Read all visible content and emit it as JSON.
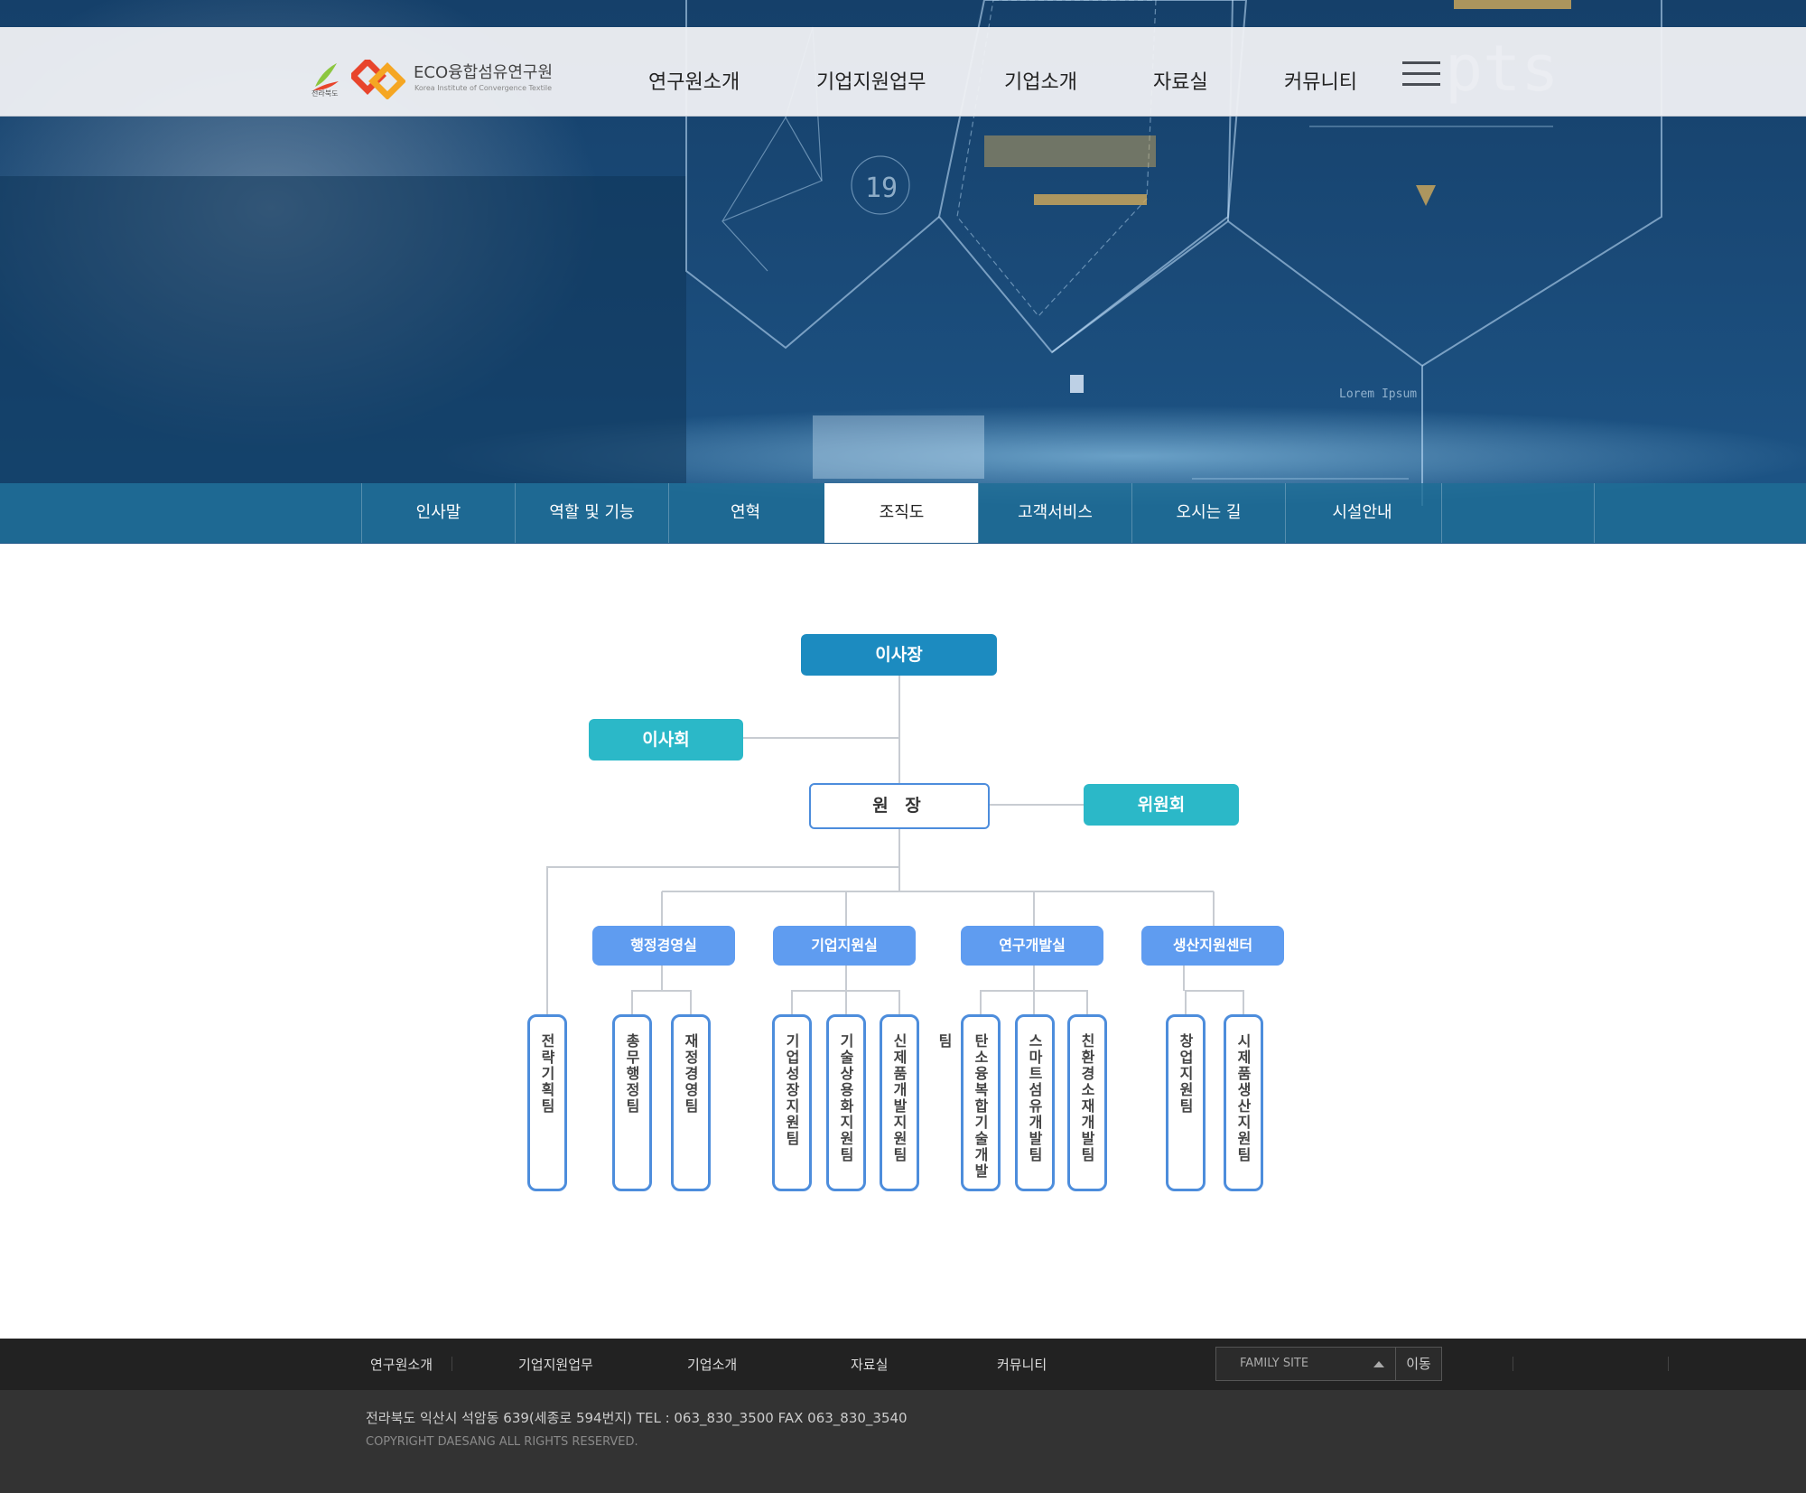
{
  "header": {
    "province_mark": "전라북도",
    "brand_name": "ECO융합섬유연구원",
    "brand_sub": "Korea Institute of Convergence Textile",
    "menu": [
      "연구원소개",
      "기업지원업무",
      "기업소개",
      "자료실",
      "커뮤니티"
    ]
  },
  "hero": {
    "hud_text": "pts",
    "hud_number": "19",
    "hud_label": "Lorem Ipsum"
  },
  "subnav": {
    "tabs": [
      "인사말",
      "역할 및 기능",
      "연혁",
      "조직도",
      "고객서비스",
      "오시는 길",
      "시설안내"
    ],
    "active_index": 3
  },
  "org": {
    "chairman": "이사장",
    "board": "이사회",
    "president": "원 장",
    "committee": "위원회",
    "direct_team": "전략기획팀",
    "departments": [
      {
        "name": "행정경영실",
        "teams": [
          "총무행정팀",
          "재정경영팀"
        ]
      },
      {
        "name": "기업지원실",
        "teams": [
          "기업성장지원팀",
          "기술상용화지원팀",
          "신제품개발지원팀"
        ]
      },
      {
        "name": "연구개발실",
        "teams": [
          "탄소융복합기술개발팀",
          "스마트섬유개발팀",
          "친환경소재개발팀"
        ]
      },
      {
        "name": "생산지원센터",
        "teams": [
          "창업지원팀",
          "시제품생산지원팀"
        ]
      }
    ]
  },
  "colors": {
    "chairman_box": "#1c8bc0",
    "teal_box": "#2bb8c8",
    "dept_box": "#5f9cf0",
    "outline": "#4d8ddc"
  },
  "footer": {
    "menu": [
      "연구원소개",
      "기업지원업무",
      "기업소개",
      "자료실",
      "커뮤니티"
    ],
    "family_site": "FAMILY SITE",
    "go_label": "이동",
    "address": "전라북도 익산시 석암동 639(세종로 594번지)   TEL : 063_830_3500    FAX   063_830_3540",
    "copyright": "COPYRIGHT DAESANG ALL RIGHTS RESERVED."
  }
}
